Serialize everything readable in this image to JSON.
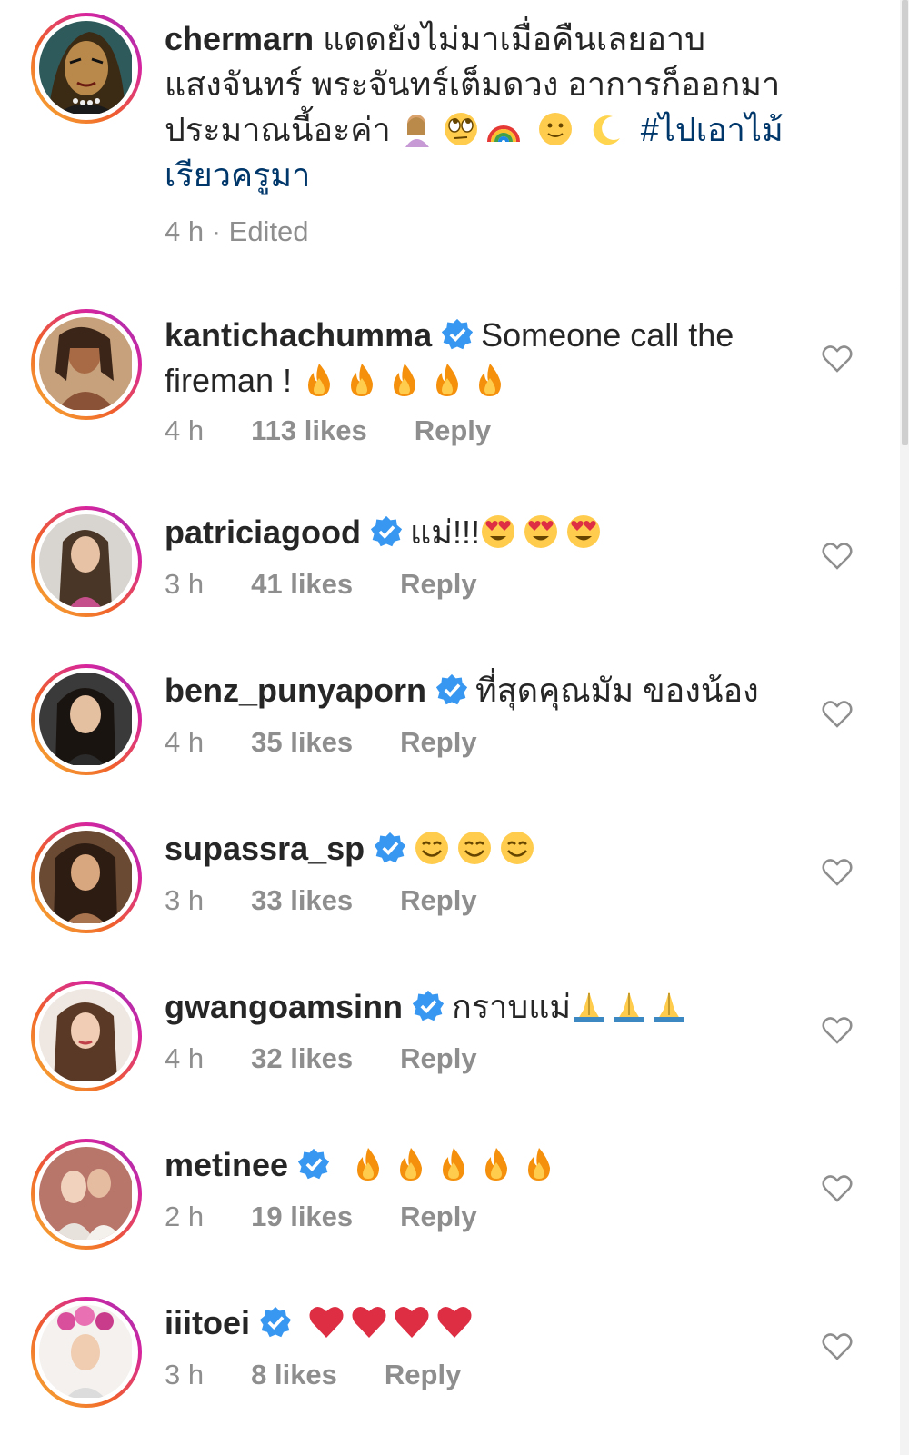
{
  "caption": {
    "username": "chermarn",
    "text": "แดดยังไม่มาเมื่อคืนเลยอาบแสงจันทร์ พระจันทร์เต็มดวง อาการก็ออกมาประมาณนี้อะค่า",
    "hashtag": "#ไปเอาไม้เรียวครูมา",
    "meta": "4 h · Edited"
  },
  "labels": {
    "reply": "Reply"
  },
  "comments": [
    {
      "username": "kantichachumma",
      "text": "Someone call the fireman !",
      "time": "4 h",
      "likes": "113 likes"
    },
    {
      "username": "patriciagood",
      "text": "แม่!!!",
      "time": "3 h",
      "likes": "41 likes"
    },
    {
      "username": "benz_punyaporn",
      "text": "ที่สุดคุณมัม ของน้อง",
      "time": "4 h",
      "likes": "35 likes"
    },
    {
      "username": "supassra_sp",
      "time": "3 h",
      "likes": "33 likes"
    },
    {
      "username": "gwangoamsinn",
      "text": "กราบแม่",
      "time": "4 h",
      "likes": "32 likes"
    },
    {
      "username": "metinee",
      "time": "2 h",
      "likes": "19 likes"
    },
    {
      "username": "iiitoei",
      "time": "3 h",
      "likes": "8 likes"
    }
  ],
  "colors": {
    "text": "#262626",
    "muted": "#8e8e8e",
    "hashtag": "#00376b",
    "verified": "#3897f0"
  }
}
